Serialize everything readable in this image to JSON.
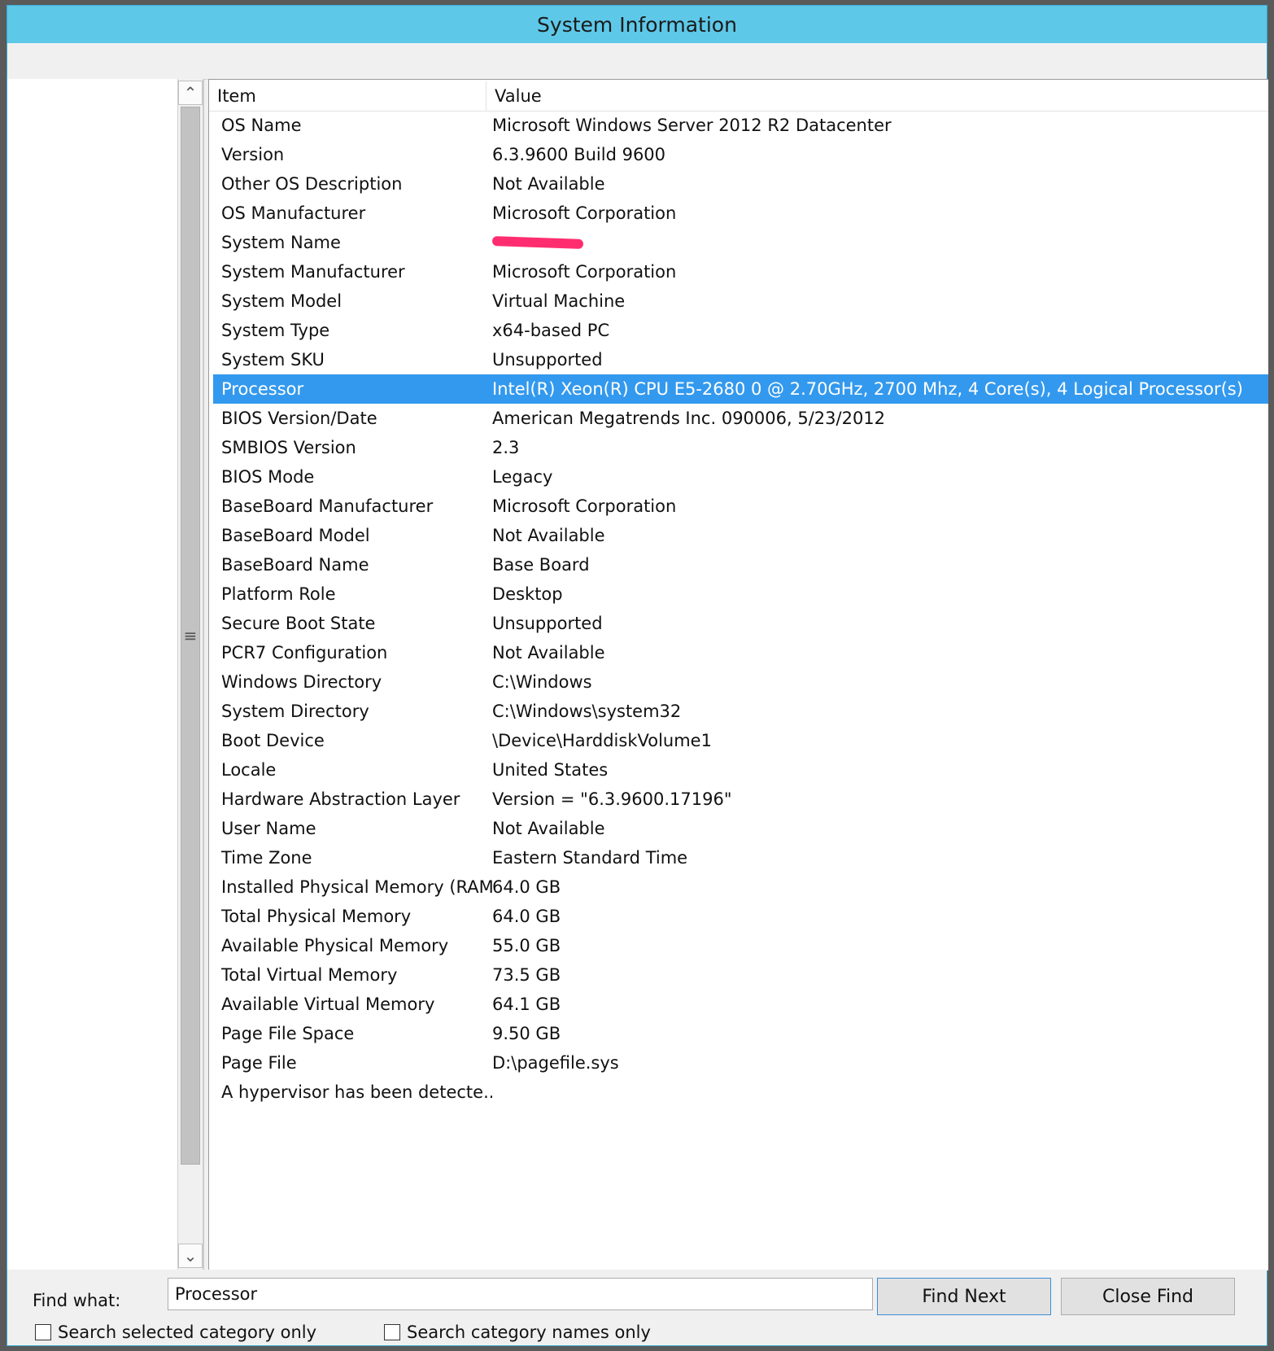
{
  "window": {
    "title": "System Information"
  },
  "list": {
    "columns": {
      "item": "Item",
      "value": "Value"
    },
    "rows": [
      {
        "item": "OS Name",
        "value": "Microsoft Windows Server 2012 R2 Datacenter"
      },
      {
        "item": "Version",
        "value": "6.3.9600 Build 9600"
      },
      {
        "item": "Other OS Description",
        "value": "Not Available"
      },
      {
        "item": "OS Manufacturer",
        "value": "Microsoft Corporation"
      },
      {
        "item": "System Name",
        "value": ""
      },
      {
        "item": "System Manufacturer",
        "value": "Microsoft Corporation"
      },
      {
        "item": "System Model",
        "value": "Virtual Machine"
      },
      {
        "item": "System Type",
        "value": "x64-based PC"
      },
      {
        "item": "System SKU",
        "value": "Unsupported"
      },
      {
        "item": "Processor",
        "value": "Intel(R) Xeon(R) CPU E5-2680 0 @ 2.70GHz, 2700 Mhz, 4 Core(s), 4 Logical Processor(s)"
      },
      {
        "item": "BIOS Version/Date",
        "value": "American Megatrends Inc. 090006, 5/23/2012"
      },
      {
        "item": "SMBIOS Version",
        "value": "2.3"
      },
      {
        "item": "BIOS Mode",
        "value": "Legacy"
      },
      {
        "item": "BaseBoard Manufacturer",
        "value": "Microsoft Corporation"
      },
      {
        "item": "BaseBoard Model",
        "value": "Not Available"
      },
      {
        "item": "BaseBoard Name",
        "value": "Base Board"
      },
      {
        "item": "Platform Role",
        "value": "Desktop"
      },
      {
        "item": "Secure Boot State",
        "value": "Unsupported"
      },
      {
        "item": "PCR7 Configuration",
        "value": "Not Available"
      },
      {
        "item": "Windows Directory",
        "value": "C:\\Windows"
      },
      {
        "item": "System Directory",
        "value": "C:\\Windows\\system32"
      },
      {
        "item": "Boot Device",
        "value": "\\Device\\HarddiskVolume1"
      },
      {
        "item": "Locale",
        "value": "United States"
      },
      {
        "item": "Hardware Abstraction Layer",
        "value": "Version = \"6.3.9600.17196\""
      },
      {
        "item": "User Name",
        "value": "Not Available"
      },
      {
        "item": "Time Zone",
        "value": "Eastern Standard Time"
      },
      {
        "item": "Installed Physical Memory (RAM)",
        "value": "64.0 GB"
      },
      {
        "item": "Total Physical Memory",
        "value": "64.0 GB"
      },
      {
        "item": "Available Physical Memory",
        "value": "55.0 GB"
      },
      {
        "item": "Total Virtual Memory",
        "value": "73.5 GB"
      },
      {
        "item": "Available Virtual Memory",
        "value": "64.1 GB"
      },
      {
        "item": "Page File Space",
        "value": "9.50 GB"
      },
      {
        "item": "Page File",
        "value": "D:\\pagefile.sys"
      },
      {
        "item": "A hypervisor has been detecte...",
        "value": ""
      }
    ],
    "selected_item": "Processor"
  },
  "find": {
    "label": "Find what:",
    "value": "Processor",
    "find_next_label": "Find Next",
    "close_find_label": "Close Find",
    "search_selected_label": "Search selected category only",
    "search_names_label": "Search category names only"
  },
  "colors": {
    "titlebar": "#5ec8e8",
    "selection": "#3399ee",
    "redaction": "#ff2d6f"
  },
  "icons": {
    "scroll_up": "chevron-up-icon",
    "scroll_down": "chevron-down-icon",
    "thumb_grip": "grip-icon"
  }
}
